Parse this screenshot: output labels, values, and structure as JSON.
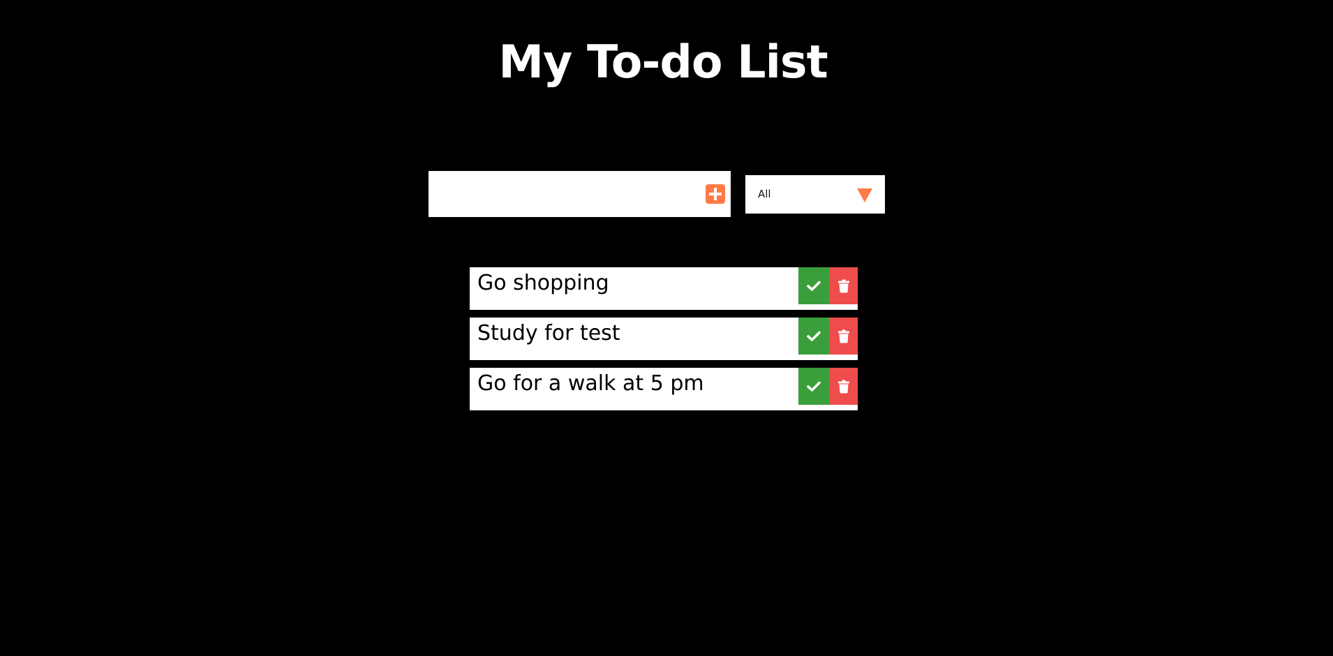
{
  "header": {
    "title": "My To-do List"
  },
  "add_form": {
    "input_value": "",
    "input_placeholder": "",
    "add_icon": "plus-square-icon"
  },
  "filter": {
    "selected": "All"
  },
  "todos": [
    {
      "text": "Go shopping"
    },
    {
      "text": "Study for test"
    },
    {
      "text": "Go for a walk at 5 pm"
    }
  ],
  "icons": {
    "complete": "check-icon",
    "delete": "trash-icon"
  },
  "colors": {
    "background": "#000000",
    "accent": "#ff7a45",
    "complete": "#3a9e3a",
    "delete": "#ef4c4c",
    "surface": "#ffffff"
  }
}
